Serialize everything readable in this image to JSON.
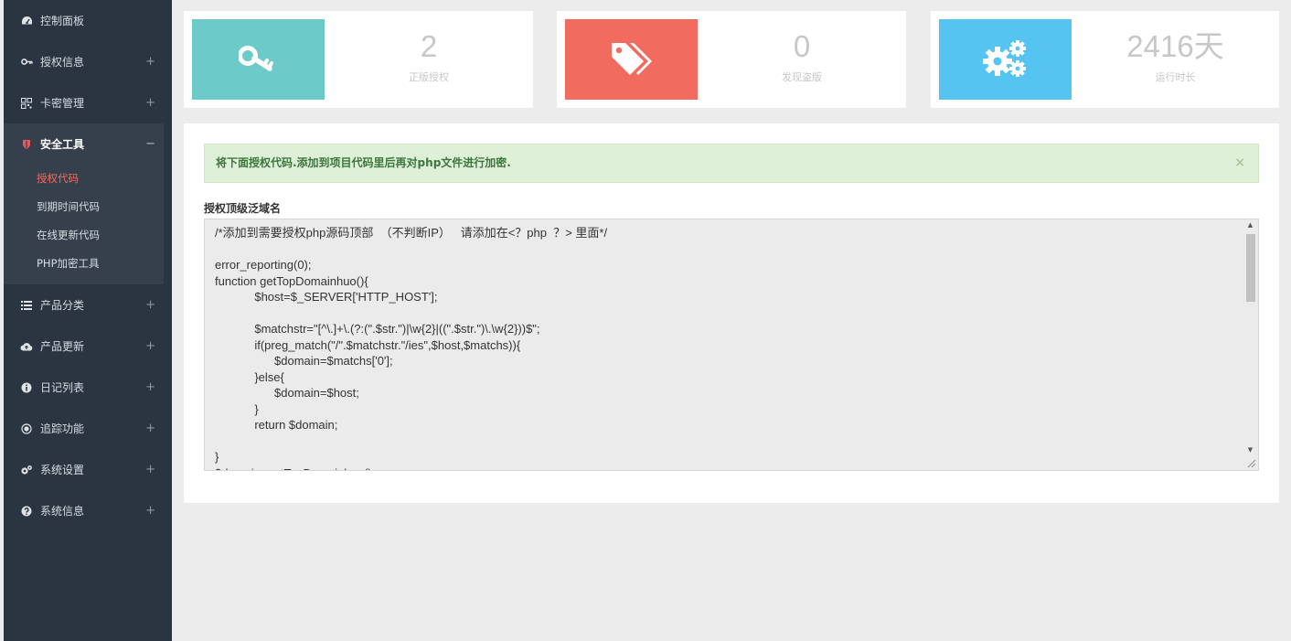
{
  "sidebar": {
    "items": [
      {
        "label": "控制面板",
        "icon": "dashboard-icon"
      },
      {
        "label": "授权信息",
        "icon": "key-icon",
        "toggle": "+"
      },
      {
        "label": "卡密管理",
        "icon": "qrcode-icon",
        "toggle": "+"
      },
      {
        "label": "安全工具",
        "icon": "shield-icon",
        "toggle": "−"
      },
      {
        "label": "产品分类",
        "icon": "list-icon",
        "toggle": "+"
      },
      {
        "label": "产品更新",
        "icon": "cloud-upload-icon",
        "toggle": "+"
      },
      {
        "label": "日记列表",
        "icon": "info-icon",
        "toggle": "+"
      },
      {
        "label": "追踪功能",
        "icon": "target-icon",
        "toggle": "+"
      },
      {
        "label": "系统设置",
        "icon": "gears-icon",
        "toggle": "+"
      },
      {
        "label": "系统信息",
        "icon": "question-icon",
        "toggle": "+"
      }
    ],
    "security_subitems": [
      "授权代码",
      "到期时间代码",
      "在线更新代码",
      "PHP加密工具"
    ],
    "active_subitem": "授权代码"
  },
  "stats": [
    {
      "value": "2",
      "caption": "正版授权",
      "color": "#6ccac8",
      "icon": "key-icon"
    },
    {
      "value": "0",
      "caption": "发现盗版",
      "color": "#f16c5f",
      "icon": "tags-icon"
    },
    {
      "value": "2416天",
      "caption": "运行时长",
      "color": "#55c4f0",
      "icon": "gears-icon"
    }
  ],
  "main": {
    "alert_text": "将下面授权代码.添加到项目代码里后再对php文件进行加密.",
    "alert_close": "×",
    "field_label": "授权顶级泛域名",
    "code": "/*添加到需要授权php源码顶部  （不判断IP）   请添加在<？php  ？> 里面*/\n\nerror_reporting(0);\nfunction getTopDomainhuo(){\n            $host=$_SERVER['HTTP_HOST'];\n\n            $matchstr=\"[^\\.]+\\.(?:(\".$str.\")|\\w{2}|((\".$str.\")\\.\\w{2}))$\";\n            if(preg_match(\"/\".$matchstr.\"/ies\",$host,$matchs)){\n                  $domain=$matchs['0'];\n            }else{\n                  $domain=$host;\n            }\n            return $domain;\n\n}\n$domain=getTopDomainhuo();"
  }
}
